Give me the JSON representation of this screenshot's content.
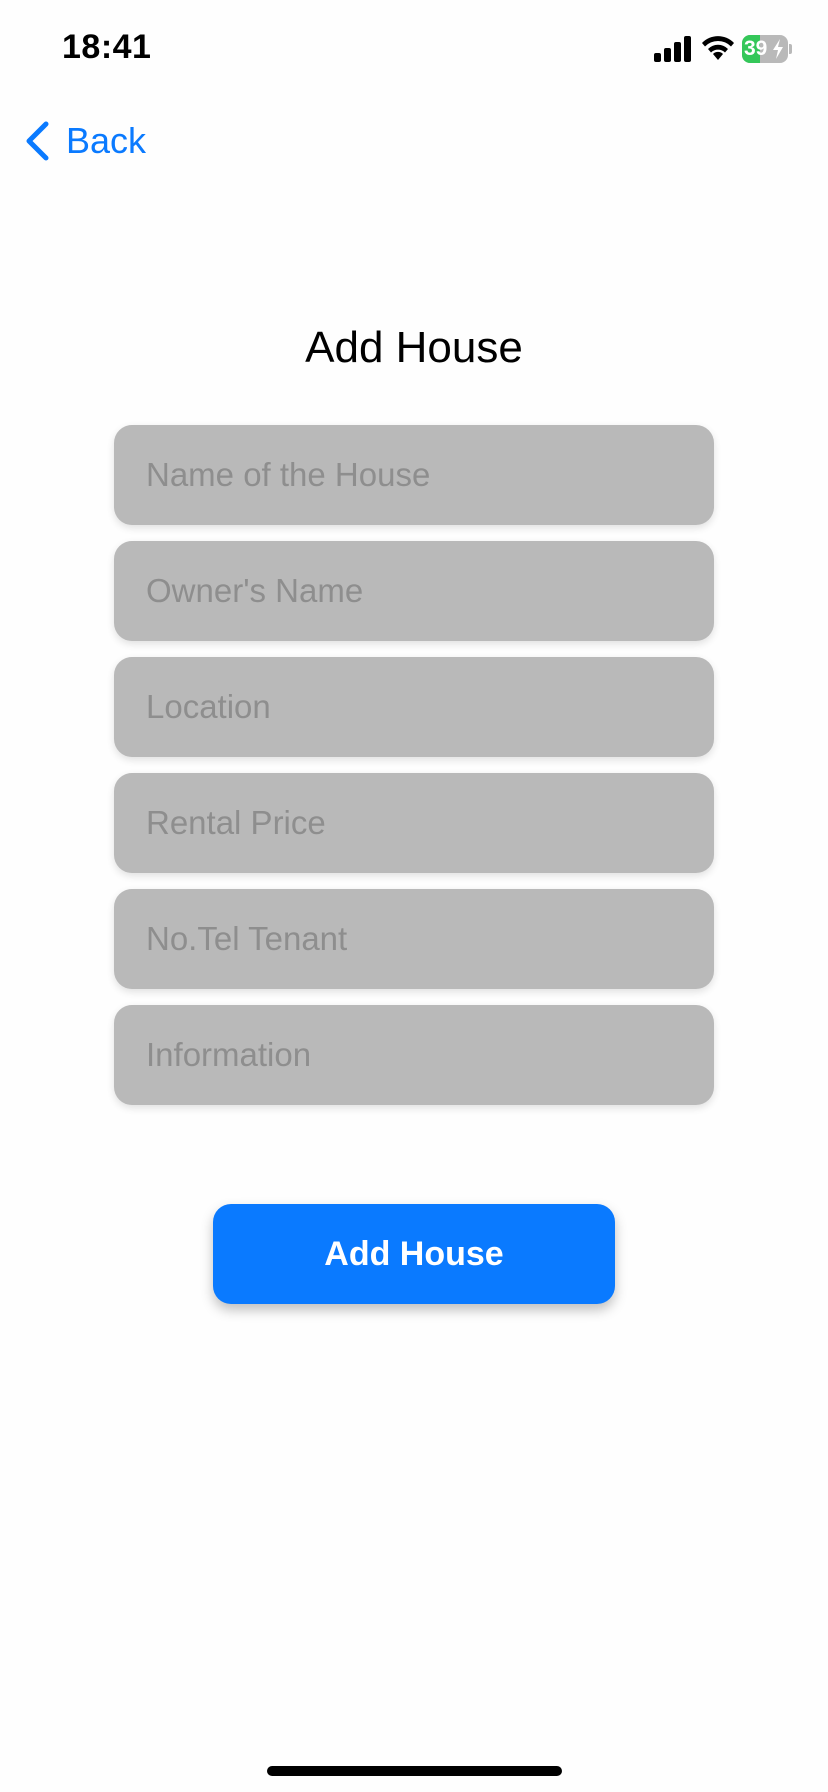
{
  "status_bar": {
    "time": "18:41",
    "battery_percent": "39",
    "battery_level": 0.39,
    "battery_color": "#34c759",
    "icons": [
      "signal-icon",
      "wifi-icon",
      "battery-icon",
      "bolt-icon"
    ]
  },
  "nav": {
    "back_label": "Back",
    "back_icon": "chevron-left-icon",
    "accent_color": "#0a7aff"
  },
  "form": {
    "title": "Add House",
    "fields": [
      {
        "placeholder": "Name of the House",
        "value": ""
      },
      {
        "placeholder": "Owner's Name",
        "value": ""
      },
      {
        "placeholder": "Location",
        "value": ""
      },
      {
        "placeholder": "Rental Price",
        "value": ""
      },
      {
        "placeholder": "No.Tel Tenant",
        "value": ""
      },
      {
        "placeholder": "Information",
        "value": ""
      }
    ],
    "field_color": "#b9b9b9",
    "submit_label": "Add House"
  }
}
